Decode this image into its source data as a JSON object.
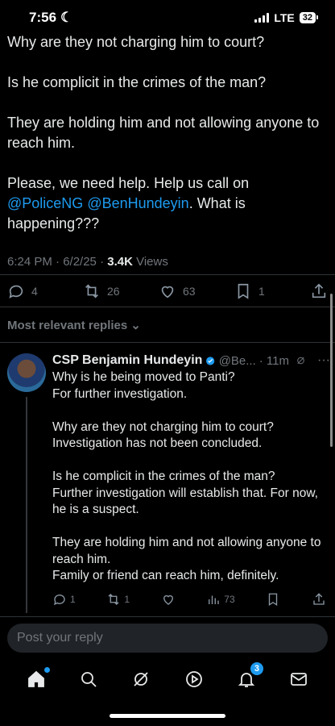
{
  "status": {
    "time": "7:56",
    "network": "LTE",
    "battery": "32"
  },
  "tweet": {
    "paragraphs": [
      "Why are they not charging him to court?",
      "Is he complicit in the crimes of the man?",
      "They are holding him and not allowing anyone to reach him."
    ],
    "last_paragraph_start": "Please, we need help. Help us call on ",
    "mention1": "@PoliceNG",
    "mention2": "@BenHundeyin",
    "last_paragraph_end": ". What is happening???",
    "timestamp": "6:24 PM · 6/2/25 · ",
    "views_count": "3.4K",
    "views_label": " Views",
    "replies": "4",
    "reposts": "26",
    "likes": "63",
    "bookmarks": "1"
  },
  "sort_label": "Most relevant replies",
  "reply": {
    "name": "CSP Benjamin Hundeyin",
    "handle": "@Be...",
    "time": "· 11m",
    "paragraphs": [
      "Why is he being moved to Panti?\nFor further investigation.",
      "Why are they not charging him to court?\nInvestigation has not been concluded.",
      "Is he complicit in the crimes of the man?\nFurther investigation will establish that. For now, he is a suspect.",
      "They are holding him and not allowing anyone to reach him.\nFamily or friend can reach him, definitely."
    ],
    "replies": "1",
    "reposts": "1",
    "views": "73"
  },
  "reply_input": {
    "placeholder": "Post your reply"
  },
  "nav": {
    "notifications_badge": "3"
  },
  "colors": {
    "accent": "#1d9bf0",
    "background": "#000000",
    "muted": "#71767b"
  }
}
